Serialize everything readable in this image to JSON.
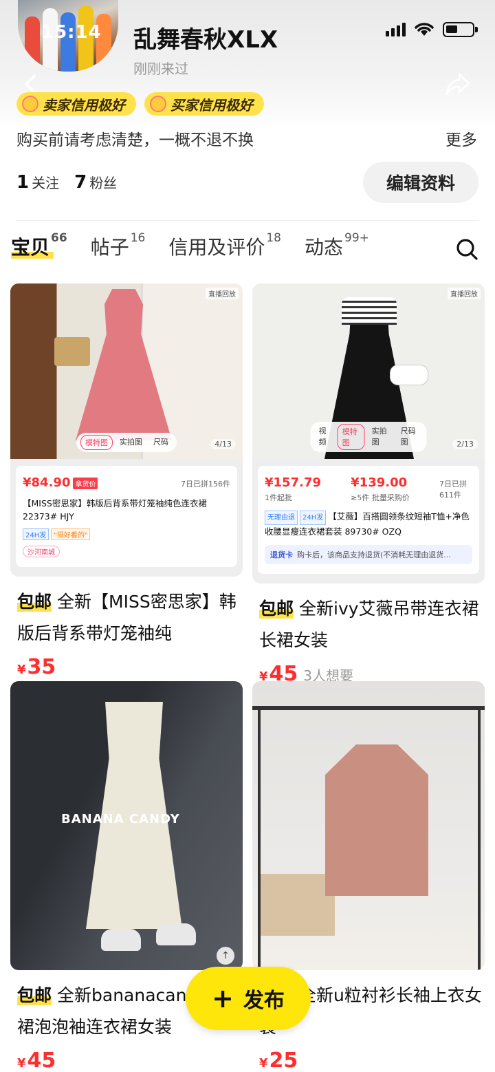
{
  "status_bar": {
    "time": "15:14"
  },
  "profile": {
    "name": "乱舞春秋XLX",
    "last_visit": "刚刚来过",
    "badges": [
      "卖家信用极好",
      "买家信用极好"
    ],
    "bio": "购买前请考虑清楚，一概不退不换",
    "more_label": "更多",
    "following_count": "1",
    "following_label": "关注",
    "fans_count": "7",
    "fans_label": "粉丝",
    "edit_label": "编辑资料"
  },
  "tabs": [
    {
      "label": "宝贝",
      "count": "66"
    },
    {
      "label": "帖子",
      "count": "16"
    },
    {
      "label": "信用及评价",
      "count": "18"
    },
    {
      "label": "动态",
      "count": "99+"
    }
  ],
  "products": [
    {
      "free_ship": "包邮",
      "title": "全新【MISS密思家】韩版后背系带灯笼袖纯",
      "price": "35",
      "currency": "¥",
      "want": "",
      "image": {
        "live": "直播回放",
        "tabs": [
          "模特图",
          "实拍图",
          "尺码"
        ],
        "count": "4/13",
        "card_price": "84.90",
        "card_tag": "拿货价",
        "card_sold": "7日已拼156件",
        "card_desc": "【MISS密思家】韩版后背系带灯笼袖纯色连衣裙 22373# HJY",
        "card_tag1": "24H发",
        "card_tag2": "\"挺好看的\"",
        "card_market": "沙河南城"
      }
    },
    {
      "free_ship": "包邮",
      "title": "全新ivy艾薇吊带连衣裙长裙女装",
      "price": "45",
      "currency": "¥",
      "want": "3人想要",
      "image": {
        "live": "直播回放",
        "tabs": [
          "视频",
          "模特图",
          "实拍图",
          "尺码图"
        ],
        "count": "2/13",
        "card_price1": "157.79",
        "card_price1_sub": "1件起批",
        "card_price2": "139.00",
        "card_price2_sub": "≥5件 批量采购价",
        "card_sold": "7日已拼 611件",
        "card_desc": "【艾薇】百搭圆领条纹短袖T恤+净色收腰显瘦连衣裙套装 89730# OZQ",
        "card_tag1": "无理由退",
        "card_tag2": "24H发",
        "refund_label": "退货卡",
        "refund_text": "购卡后，该商品支持退货(不消耗无理由退货..."
      }
    },
    {
      "free_ship": "包邮",
      "title": "全新bananacandy 衣裙泡泡袖连衣裙女装",
      "price": "45",
      "currency": "¥",
      "want": "",
      "image": {
        "brand": "BANANA CANDY"
      }
    },
    {
      "free_ship": "包邮",
      "title": "全新u粒衬衫长袖上衣女装",
      "price": "25",
      "currency": "¥",
      "want": "",
      "image": {}
    }
  ],
  "fab": {
    "label": "发布"
  }
}
